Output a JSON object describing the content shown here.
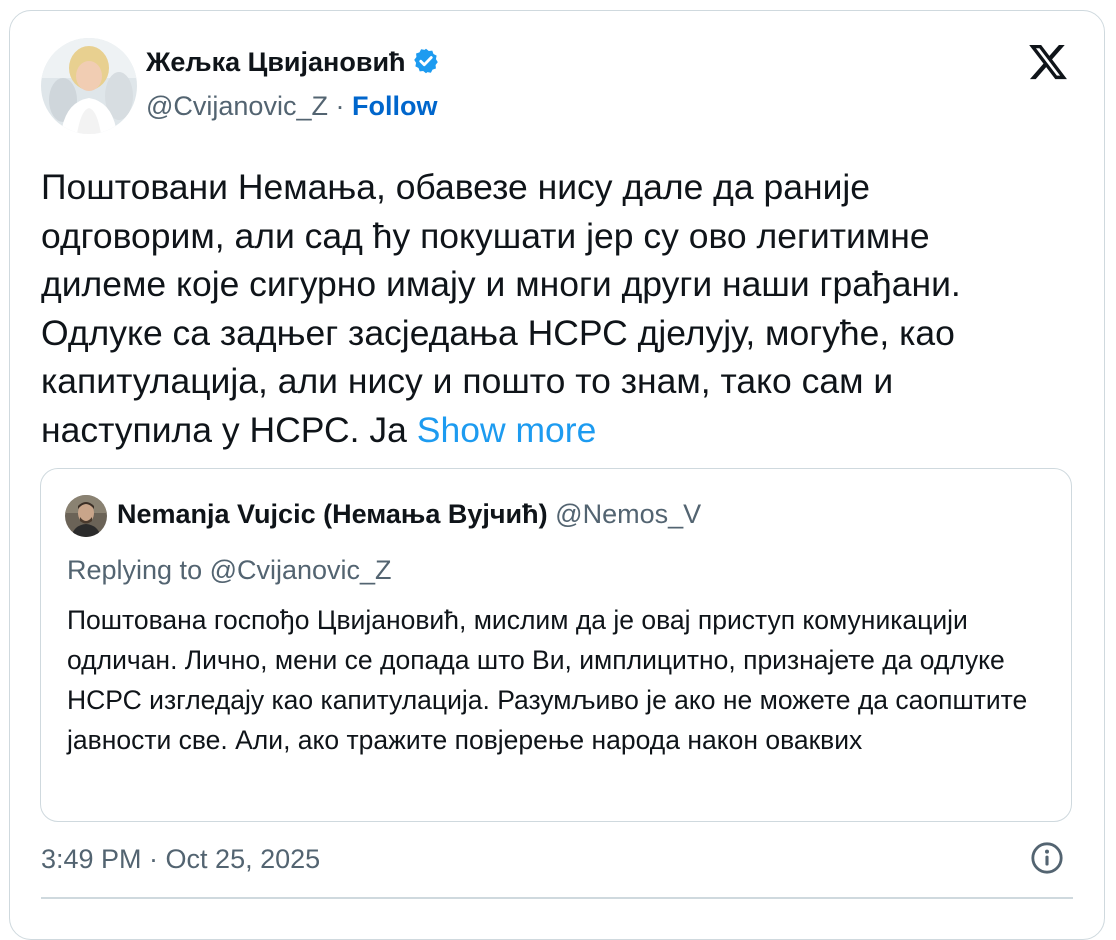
{
  "author": {
    "name": "Жељка Цвијановић",
    "handle": "@Cvijanovic_Z",
    "separator": " · ",
    "follow_label": "Follow",
    "verified": true
  },
  "icons": {
    "verified": "verified-badge-icon",
    "logo": "x-logo-icon",
    "info": "info-icon"
  },
  "tweet": {
    "text": "Поштовани Немања, обавезе нису дале да раније одговорим, али сад ћу покушати јер су ово легитимне дилеме које сигурно имају и многи други наши грађани. Одлуке са задњег засједања НСРС дјелују, могуће, као капитулација, али нису и пошто то знам, тако сам и наступила у НСРС. Ја ",
    "show_more_label": "Show more",
    "timestamp": "3:49 PM · Oct 25, 2025"
  },
  "quoted": {
    "name": "Nemanja Vujcic (Немања Вујчић)",
    "handle": "@Nemos_V",
    "replying_to": "Replying to @Cvijanovic_Z",
    "text": "Поштована госпођо Цвијановић, мислим да је овај приступ комуникацији одличан. Лично, мени се допада што Ви, имплицитно, признајете да одлуке НСРС изгледају као капитулација. Разумљиво је ако не можете да саопштите јавности све. Али, ако тражите повјерење народа након оваквих"
  },
  "colors": {
    "text": "#0f1419",
    "secondary": "#536471",
    "link": "#1d9bf0",
    "follow": "#0066cc",
    "border": "#cfd9de"
  }
}
